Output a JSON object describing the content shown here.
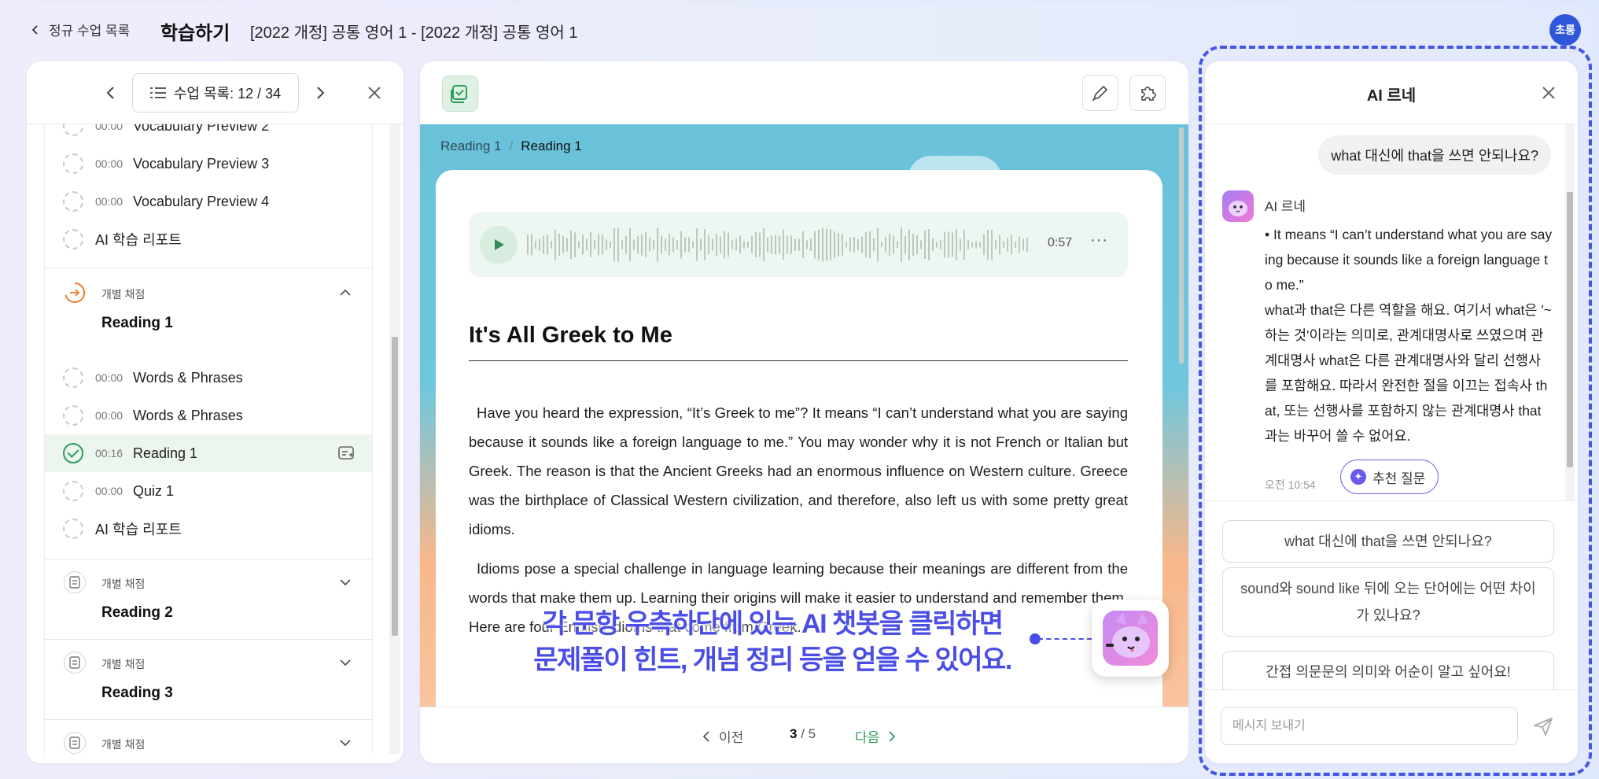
{
  "header": {
    "back_label": "정규 수업 목록",
    "page_title": "학습하기",
    "course_title": "[2022 개정] 공통 영어 1 - [2022 개정] 공통 영어 1",
    "profile_label": "초롱"
  },
  "lesson_nav": {
    "count_label": "수업 목록: 12 / 34",
    "items": [
      {
        "time": "00:00",
        "label": "Vocabulary Preview 2"
      },
      {
        "time": "00:00",
        "label": "Vocabulary Preview 3"
      },
      {
        "time": "00:00",
        "label": "Vocabulary Preview 4"
      },
      {
        "time": "",
        "label": "AI 학습 리포트"
      }
    ],
    "sections": [
      {
        "tag": "개별 채점",
        "title": "Reading 1",
        "expanded": true,
        "items": [
          {
            "time": "00:00",
            "label": "Words & Phrases"
          },
          {
            "time": "00:00",
            "label": "Words & Phrases"
          },
          {
            "time": "00:16",
            "label": "Reading 1",
            "active": true
          },
          {
            "time": "00:00",
            "label": "Quiz 1"
          },
          {
            "time": "",
            "label": "AI 학습 리포트"
          }
        ]
      },
      {
        "tag": "개별 채점",
        "title": "Reading 2",
        "expanded": false
      },
      {
        "tag": "개별 채점",
        "title": "Reading 3",
        "expanded": false
      },
      {
        "tag": "개별 채점",
        "title": "",
        "expanded": false
      }
    ]
  },
  "content": {
    "breadcrumb": [
      "Reading 1",
      "Reading 1"
    ],
    "audio": {
      "duration": "0:57",
      "more": "···"
    },
    "title": "It's All Greek to Me",
    "paragraphs": [
      "Have you heard the expression, “It’s Greek to me”? It means “I can’t understand what you are saying because it sounds like a foreign language to me.” You may wonder why it is not French or Italian but Greek. The reason is that the Ancient Greeks had an enormous influence on Western culture. Greece was the birthplace of Classical Western civilization, and therefore, also left us with some pretty great idioms.",
      "Idioms pose a special challenge in language learning because their meanings are different from the words that make them up. Learning their origins will make it easier to understand and remember them. Here are four English idioms that come from Greek."
    ],
    "pager": {
      "prev": "이전",
      "current": "3",
      "total": "5",
      "next": "다음"
    }
  },
  "annotation": {
    "lines": [
      "각 문항 우측하단에 있는 AI 챗봇을 클릭하면",
      "문제풀이 힌트, 개념 정리 등을 얻을 수 있어요."
    ]
  },
  "assistant": {
    "title": "AI 르네",
    "user_message": "what 대신에 that을 쓰면 안되나요?",
    "bot_name": "AI 르네",
    "bot_lines": [
      "• It means “I can’t understand what you are saying because it sounds like a foreign language to me.”",
      "what과 that은 다른 역할을 해요. 여기서 what은 '~하는 것'이라는 의미로, 관계대명사로 쓰였으며 관계대명사 what은 다른 관계대명사와 달리 선행사를 포함해요. 따라서 완전한 절을 이끄는 접속사 that, 또는 선행사를 포함하지 않는 관계대명사 that과는 바꾸어 쓸 수 없어요."
    ],
    "bot_time": "오전 10:54",
    "recommend_label": "추천 질문",
    "suggestions": [
      "what 대신에 that을 쓰면 안되나요?",
      "sound와 sound like 뒤에 오는 단어에는 어떤 차이가 있나요?",
      "간접 의문문의 의미와 어순이 알고 싶어요!"
    ],
    "input_placeholder": "메시지 보내기"
  }
}
